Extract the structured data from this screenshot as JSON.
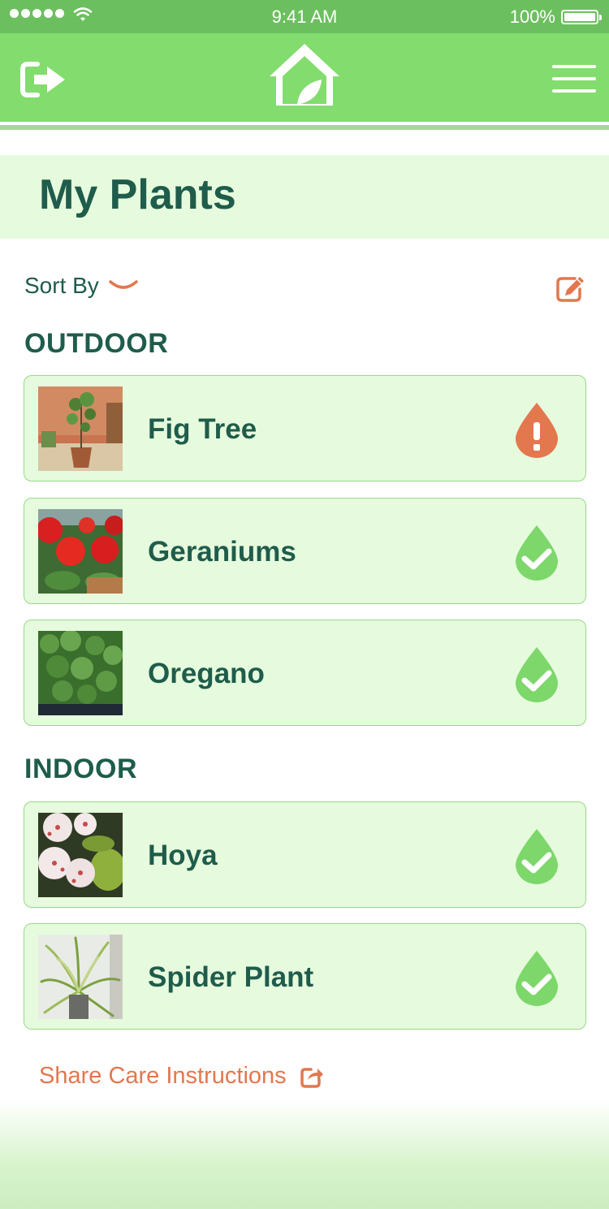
{
  "status_bar": {
    "time": "9:41 AM",
    "battery": "100%"
  },
  "header": {
    "logout_icon": "logout-icon",
    "logo_icon": "home-leaf-icon",
    "menu_icon": "hamburger-menu-icon"
  },
  "page": {
    "title": "My Plants"
  },
  "toolbar": {
    "sort_label": "Sort By",
    "sort_icon": "chevron-down-icon",
    "edit_icon": "edit-icon"
  },
  "sections": [
    {
      "heading": "OUTDOOR",
      "plants": [
        {
          "name": "Fig Tree",
          "status": "needs-water"
        },
        {
          "name": "Geraniums",
          "status": "ok"
        },
        {
          "name": "Oregano",
          "status": "ok"
        }
      ]
    },
    {
      "heading": "INDOOR",
      "plants": [
        {
          "name": "Hoya",
          "status": "ok"
        },
        {
          "name": "Spider Plant",
          "status": "ok"
        }
      ]
    }
  ],
  "footer": {
    "share_label": "Share Care Instructions",
    "share_icon": "share-icon"
  },
  "colors": {
    "brand_green": "#83dc6e",
    "dark_green": "#1f5c4b",
    "card_bg": "#e6fbdd",
    "accent_orange": "#e3774e",
    "ok_green": "#7dd76b"
  }
}
